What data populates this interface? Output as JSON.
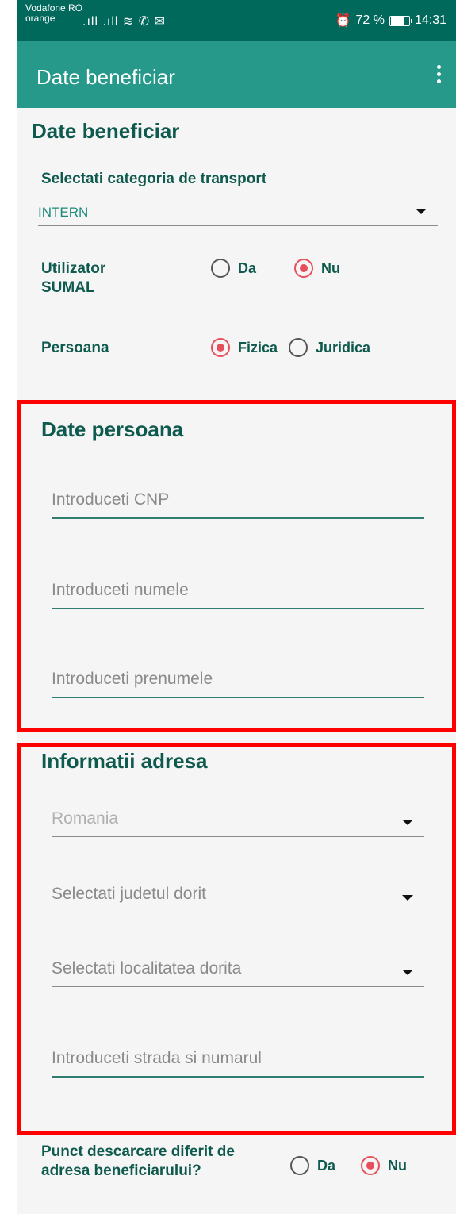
{
  "status_bar": {
    "carrier_1": "Vodafone RO",
    "carrier_2": "orange",
    "signals": ".ıll .ıll ≋ ✆ ✉",
    "alarm_icon": "alarm-icon",
    "battery": "72 %",
    "time": "14:31"
  },
  "app_bar": {
    "title": "Date beneficiar",
    "more_icon": "more-vert-icon"
  },
  "beneficiar": {
    "section_title": "Date beneficiar",
    "transport_label": "Selectati categoria de transport",
    "transport_value": "INTERN",
    "utilizator_label": "Utilizator SUMAL",
    "utilizator_options": [
      "Da",
      "Nu"
    ],
    "utilizator_selected": "Nu",
    "persoana_label": "Persoana",
    "persoana_options": [
      "Fizica",
      "Juridica"
    ],
    "persoana_selected": "Fizica"
  },
  "persoana": {
    "section_title": "Date persoana",
    "cnp_placeholder": "Introduceti CNP",
    "nume_placeholder": "Introduceti numele",
    "prenume_placeholder": "Introduceti prenumele"
  },
  "adresa": {
    "section_title": "Informatii adresa",
    "tara_value": "Romania",
    "judet_placeholder": "Selectati judetul dorit",
    "localitate_placeholder": "Selectati localitatea dorita",
    "strada_placeholder": "Introduceti strada si numarul"
  },
  "descarcare": {
    "label": "Punct descarcare diferit de adresa beneficiarului?",
    "options": [
      "Da",
      "Nu"
    ],
    "selected": "Nu"
  },
  "colors": {
    "status_bar": "#00695c",
    "app_bar": "#26998a",
    "accent": "#e84f5c",
    "heading": "#0f5a4e",
    "highlight_box": "#ff0000"
  }
}
